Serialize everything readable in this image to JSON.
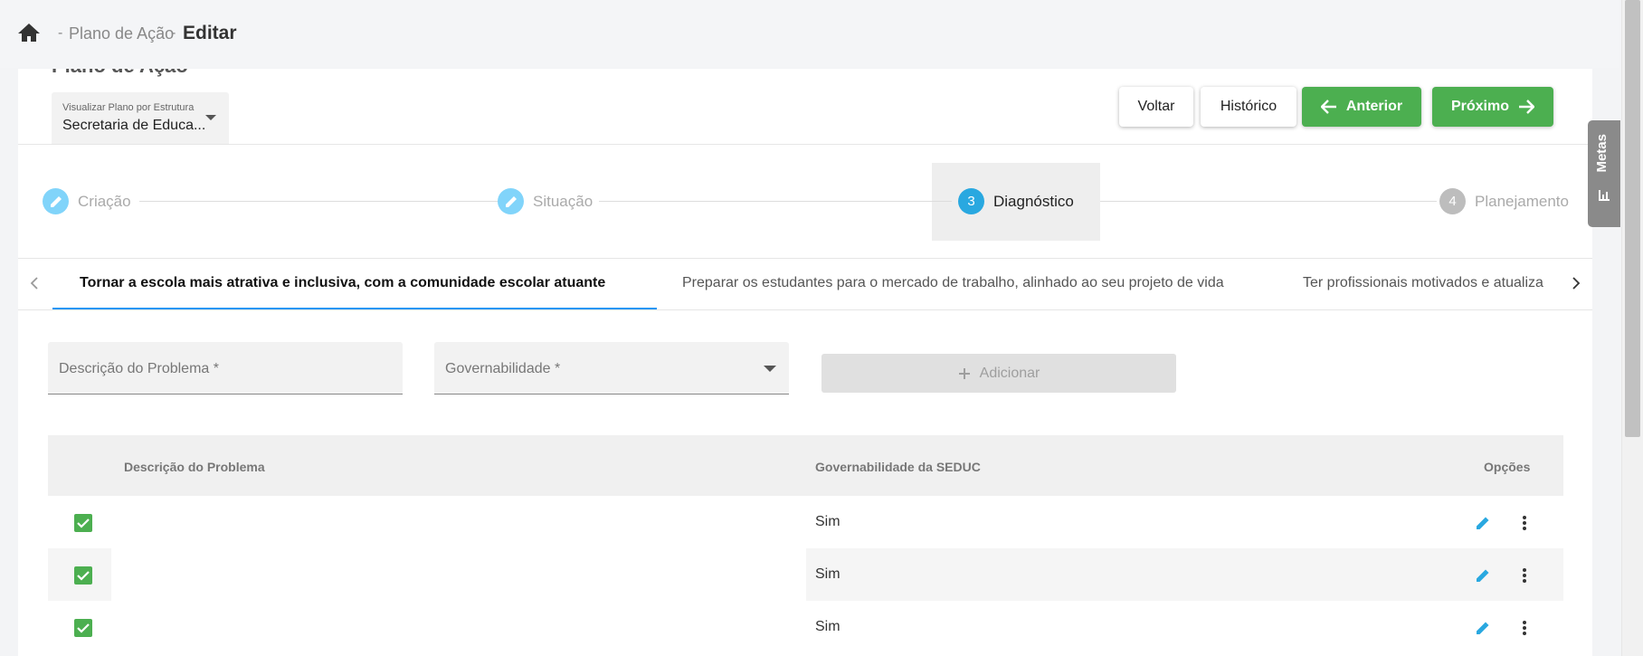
{
  "breadcrumb": {
    "items": [
      "Plano de Ação"
    ],
    "current": "Editar"
  },
  "page": {
    "title": "Plano de Ação"
  },
  "structure_select": {
    "label": "Visualizar Plano por Estrutura",
    "value": "Secretaria de Educa..."
  },
  "toolbar": {
    "back_label": "Voltar",
    "history_label": "Histórico",
    "previous_label": "Anterior",
    "next_label": "Próximo"
  },
  "stepper": {
    "steps": [
      {
        "number": "",
        "label": "Criação",
        "state": "done"
      },
      {
        "number": "",
        "label": "Situação",
        "state": "done"
      },
      {
        "number": "3",
        "label": "Diagnóstico",
        "state": "active"
      },
      {
        "number": "4",
        "label": "Planejamento",
        "state": "pending"
      }
    ]
  },
  "tabs": [
    {
      "label": "Tornar a escola mais atrativa e inclusiva, com a comunidade escolar atuante",
      "active": true
    },
    {
      "label": "Preparar os estudantes para o mercado de trabalho, alinhado ao seu projeto de vida",
      "active": false
    },
    {
      "label": "Ter profissionais motivados e atualiza",
      "active": false
    }
  ],
  "form": {
    "problem_label": "Descrição do Problema *",
    "governability_label": "Governabilidade *",
    "add_label": "Adicionar"
  },
  "table": {
    "columns": [
      "Descrição do Problema",
      "Governabilidade da SEDUC",
      "Opções"
    ],
    "rows": [
      {
        "description": "",
        "governability": "Sim",
        "checked": true
      },
      {
        "description": "",
        "governability": "Sim",
        "checked": true
      },
      {
        "description": "",
        "governability": "Sim",
        "checked": true
      }
    ]
  },
  "side_tab": {
    "label": "Metas",
    "icon": "chart-icon"
  },
  "colors": {
    "primary_green": "#4caf50",
    "accent_blue": "#2196f3",
    "step_done": "#81d4fa",
    "step_active": "#29a8e0",
    "step_pending": "#bdbdbd"
  }
}
